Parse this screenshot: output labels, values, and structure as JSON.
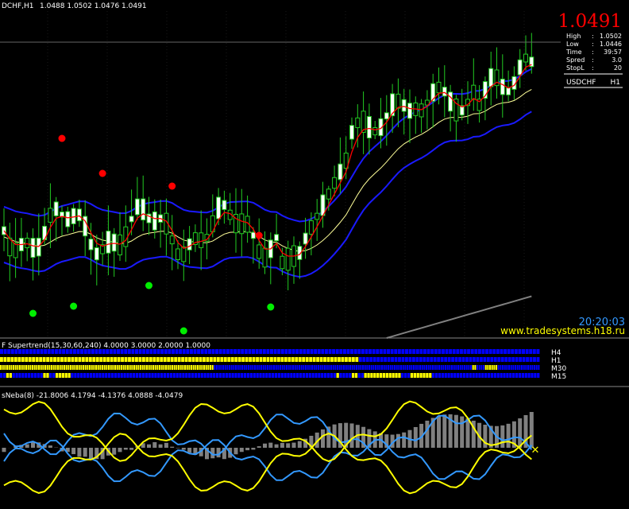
{
  "header": {
    "symbol_tf": "DCHF,H1",
    "ohlc": "1.0488 1.0502 1.0476 1.0491"
  },
  "price_panel": {
    "big_price": "1.0491",
    "rows": [
      {
        "label": "High",
        "value": "1.0502"
      },
      {
        "label": "Low",
        "value": "1.0446"
      },
      {
        "label": "Time",
        "value": "39:57"
      },
      {
        "label": "Spred",
        "value": "3.0"
      },
      {
        "label": "StopL",
        "value": "20"
      }
    ],
    "symbol": "USDCHF",
    "timeframe": "H1",
    "clock": "20:20:03",
    "website": "www.tradesystems.h18.ru"
  },
  "supertrend": {
    "title": "F Supertrend(15,30,60,240) 4.0000 3.0000 2.0000 1.0000",
    "rows": [
      {
        "label": "H4",
        "pattern": "bbbbbbbbbbbbbbbbbbbbbbbbbbbbbbbbbbbbbbbbbbbbbbbbbbbbbbbbbbbbbbbbbbbbbbbbbbbbbbbbbbbbbbbbbbbbbbbbbbbbbbbbbbbbbbbbbbbbbbbbbbbbbbbbbbbbbbbbbbbbbbbbbbbb"
      },
      {
        "label": "H1",
        "pattern": "yyyyyyyyyyyyyyyyyyyyyyyyyyyyyyyyyyyyyyyyyyyyyyyyyyyyyyyyyyyyyyyyyyyyyyyyyyyyyyyyyyyyyyyyyyyyyyyyyyyyybbbbbbbbbbbbbbbbbbbbbbbbbbbbbbbbbbbbbbbbbbbbbbbbbbb"
      },
      {
        "label": "M30",
        "pattern": "yyyyyyyyyyyyyyyyyyyyyyyyyyyyyyyyyyyyyyyyyyyyyyyyyyyyyyyyyyyyyyyyyyyyyyyyyyyyyyyyyyyyyyyyyyyyyyyyyyyyybbbbbbbbbbbbbbbbbbbbbbbbbbbbbbbbbbbbbbbbbbbbbbbbbbbbbbbbbbbbbbbbbbbbbbbbbbbbbbbbbbbbbbbbbbbbbbbbbbbbbbbbbbbbbbbbbbbbbbbbbbyybbbbyyyyyybbbbbbbbbbbbbbbbbbbb"
      },
      {
        "label": "M15",
        "pattern": "bbyybbbbbbbbbbyybbyyyyybbbbbbbbbbbbbbbbbbbbbbbbbbbbbbbbbbbbbbbbbbbbbbbbbbbbbbbbbbbbbbbbbbbbbbbbbbbbbbbbbbbbbbybbbbyybbyyyyyyyyyyyybbbyyyyyyybbbbbbbbbbbbbbbbbbbbbbbbbbbbbbbbbbb"
      }
    ]
  },
  "oscillator": {
    "title": "sNeba(8) -21.8006 4.1794 -4.1376 4.0888 -4.0479"
  },
  "colors": {
    "background": "#000000",
    "bull_candle": "#ffffff",
    "bear_candle": "#000000",
    "candle_border": "#22cc22",
    "fast_ma": "#ff0000",
    "mid_ma": "#ffff99",
    "band": "#1a1aff",
    "slow_ma": "#808080",
    "fractal_up": "#ff0000",
    "fractal_down": "#00ee00",
    "big_price": "#ff0000",
    "clock": "#3399ff",
    "website": "#ffff00",
    "panel_text": "#ffffff",
    "panel_value": "#ffffff",
    "st_blue": "#0000ff",
    "st_yellow": "#ffff00",
    "osc_hist": "#808080",
    "osc_blue": "#3399ff",
    "osc_yellow": "#ffff00"
  }
}
